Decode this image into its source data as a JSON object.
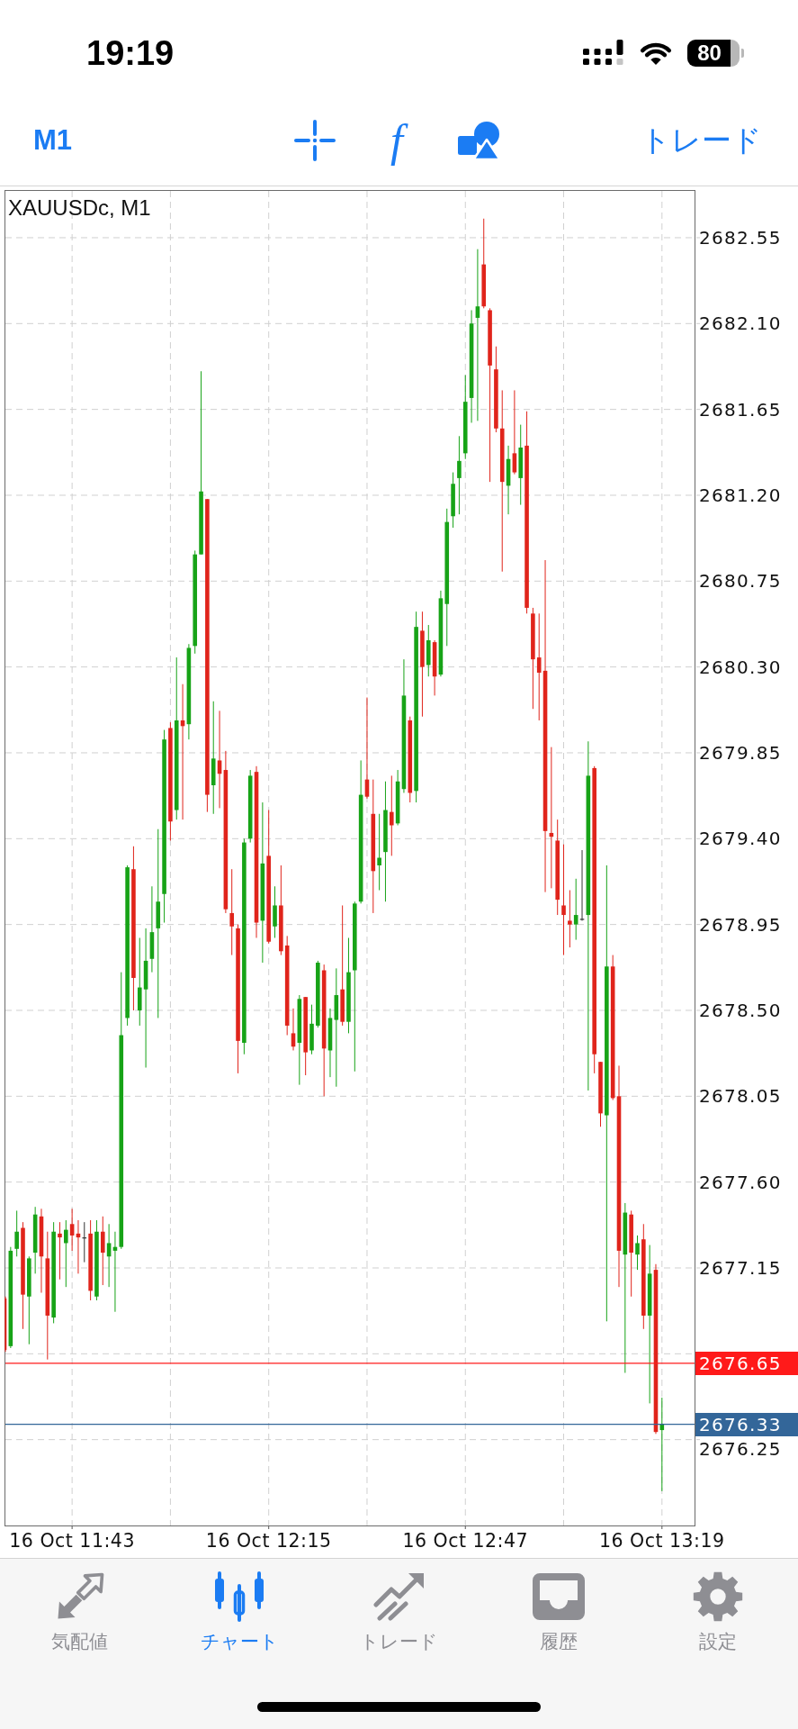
{
  "status_bar": {
    "time": "19:19",
    "battery": "80"
  },
  "toolbar": {
    "timeframe": "M1",
    "indicators": "f",
    "trade": "トレード"
  },
  "chart": {
    "chart_data": {
      "type": "candlestick",
      "title": "XAUUSDc, M1",
      "grid": true,
      "categories": [
        null,
        null,
        null,
        null,
        null,
        null,
        null,
        null,
        null,
        null,
        null,
        "16 Oct 11:43",
        null,
        null,
        null,
        null,
        null,
        null,
        null,
        null,
        null,
        null,
        null,
        null,
        null,
        null,
        null,
        null,
        null,
        null,
        null,
        null,
        null,
        null,
        null,
        null,
        null,
        null,
        null,
        null,
        null,
        null,
        null,
        "16 Oct 12:15",
        null,
        null,
        null,
        null,
        null,
        null,
        null,
        null,
        null,
        null,
        null,
        null,
        null,
        null,
        null,
        null,
        null,
        null,
        null,
        null,
        null,
        null,
        null,
        null,
        null,
        null,
        null,
        null,
        null,
        null,
        null,
        "16 Oct 12:47",
        null,
        null,
        null,
        null,
        null,
        null,
        null,
        null,
        null,
        null,
        null,
        null,
        null,
        null,
        null,
        null,
        null,
        null,
        null,
        null,
        null,
        null,
        null,
        null,
        null,
        null,
        null,
        null,
        null,
        null,
        null,
        "16 Oct 13:19"
      ],
      "ohlc": [
        [
          2676.99,
          2677.0,
          2676.71,
          2676.72
        ],
        [
          2676.74,
          2677.26,
          2676.73,
          2677.24
        ],
        [
          2677.25,
          2677.45,
          2677.21,
          2677.34
        ],
        [
          2677.36,
          2677.39,
          2676.83,
          2677.01
        ],
        [
          2677.0,
          2677.21,
          2676.75,
          2677.2
        ],
        [
          2677.23,
          2677.47,
          2677.12,
          2677.43
        ],
        [
          2677.42,
          2677.46,
          2677.02,
          2677.21
        ],
        [
          2677.2,
          2677.34,
          2676.67,
          2676.9
        ],
        [
          2676.89,
          2677.39,
          2676.86,
          2677.34
        ],
        [
          2677.33,
          2677.39,
          2677.09,
          2677.31
        ],
        [
          2677.28,
          2677.4,
          2677.05,
          2677.35
        ],
        [
          2677.38,
          2677.46,
          2677.24,
          2677.32
        ],
        [
          2677.33,
          2677.4,
          2677.12,
          2677.31
        ],
        [
          2677.31,
          2677.39,
          2677.18,
          2677.31
        ],
        [
          2677.33,
          2677.4,
          2676.98,
          2677.03
        ],
        [
          2677.0,
          2677.4,
          2676.98,
          2677.34
        ],
        [
          2677.34,
          2677.42,
          2677.06,
          2677.23
        ],
        [
          2677.21,
          2677.38,
          2677.05,
          2677.28
        ],
        [
          2677.24,
          2677.34,
          2676.92,
          2677.26
        ],
        [
          2677.26,
          2678.7,
          2677.25,
          2678.37
        ],
        [
          2678.46,
          2679.26,
          2678.42,
          2679.25
        ],
        [
          2679.24,
          2679.36,
          2678.5,
          2678.67
        ],
        [
          2678.5,
          2678.88,
          2678.42,
          2678.62
        ],
        [
          2678.61,
          2678.93,
          2678.2,
          2678.76
        ],
        [
          2678.77,
          2679.15,
          2678.7,
          2678.91
        ],
        [
          2678.93,
          2679.45,
          2678.46,
          2679.07
        ],
        [
          2679.11,
          2679.97,
          2678.96,
          2679.92
        ],
        [
          2679.98,
          2680.01,
          2679.39,
          2679.49
        ],
        [
          2679.55,
          2680.35,
          2679.5,
          2680.02
        ],
        [
          2680.02,
          2680.21,
          2679.5,
          2679.99
        ],
        [
          2680.0,
          2680.42,
          2679.92,
          2680.4
        ],
        [
          2680.41,
          2680.91,
          2680.37,
          2680.89
        ],
        [
          2680.89,
          2681.85,
          2680.89,
          2681.22
        ],
        [
          2681.18,
          2681.18,
          2679.54,
          2679.63
        ],
        [
          2679.68,
          2680.12,
          2679.53,
          2679.82
        ],
        [
          2679.81,
          2680.07,
          2679.56,
          2679.74
        ],
        [
          2679.76,
          2679.86,
          2679.01,
          2679.03
        ],
        [
          2679.01,
          2679.24,
          2678.79,
          2678.94
        ],
        [
          2678.93,
          2678.95,
          2678.17,
          2678.34
        ],
        [
          2678.33,
          2679.4,
          2678.27,
          2679.38
        ],
        [
          2679.4,
          2679.76,
          2679.38,
          2679.73
        ],
        [
          2679.75,
          2679.78,
          2678.88,
          2678.96
        ],
        [
          2678.97,
          2679.59,
          2678.75,
          2679.27
        ],
        [
          2679.31,
          2679.55,
          2678.85,
          2678.86
        ],
        [
          2678.94,
          2679.15,
          2678.88,
          2679.05
        ],
        [
          2679.05,
          2679.26,
          2678.79,
          2678.81
        ],
        [
          2678.84,
          2678.89,
          2678.37,
          2678.42
        ],
        [
          2678.38,
          2678.51,
          2678.29,
          2678.31
        ],
        [
          2678.33,
          2678.58,
          2678.11,
          2678.56
        ],
        [
          2678.57,
          2678.57,
          2678.16,
          2678.28
        ],
        [
          2678.29,
          2678.53,
          2678.27,
          2678.43
        ],
        [
          2678.42,
          2678.76,
          2678.41,
          2678.75
        ],
        [
          2678.71,
          2678.74,
          2678.05,
          2678.3
        ],
        [
          2678.29,
          2678.51,
          2678.15,
          2678.46
        ],
        [
          2678.45,
          2678.72,
          2678.1,
          2678.58
        ],
        [
          2678.61,
          2679.05,
          2678.42,
          2678.44
        ],
        [
          2678.44,
          2678.88,
          2678.38,
          2678.7
        ],
        [
          2678.71,
          2679.07,
          2678.18,
          2679.06
        ],
        [
          2679.07,
          2679.81,
          2679.06,
          2679.63
        ],
        [
          2679.71,
          2680.14,
          2679.61,
          2679.62
        ],
        [
          2679.53,
          2679.71,
          2679.01,
          2679.23
        ],
        [
          2679.26,
          2679.53,
          2679.13,
          2679.3
        ],
        [
          2679.33,
          2679.7,
          2679.07,
          2679.55
        ],
        [
          2679.54,
          2679.73,
          2679.31,
          2679.47
        ],
        [
          2679.48,
          2679.76,
          2679.47,
          2679.7
        ],
        [
          2679.66,
          2680.34,
          2679.64,
          2680.15
        ],
        [
          2680.02,
          2680.04,
          2679.59,
          2679.64
        ],
        [
          2679.65,
          2680.59,
          2679.59,
          2680.51
        ],
        [
          2680.49,
          2680.59,
          2680.04,
          2680.3
        ],
        [
          2680.31,
          2680.52,
          2680.25,
          2680.44
        ],
        [
          2680.43,
          2680.44,
          2680.15,
          2680.25
        ],
        [
          2680.26,
          2680.7,
          2680.25,
          2680.66
        ],
        [
          2680.63,
          2681.13,
          2680.41,
          2681.06
        ],
        [
          2681.09,
          2681.32,
          2681.03,
          2681.26
        ],
        [
          2681.29,
          2681.51,
          2681.1,
          2681.38
        ],
        [
          2681.42,
          2681.83,
          2681.39,
          2681.69
        ],
        [
          2681.71,
          2682.17,
          2681.58,
          2682.1
        ],
        [
          2682.13,
          2682.49,
          2681.59,
          2682.19
        ],
        [
          2682.41,
          2682.65,
          2682.18,
          2682.19
        ],
        [
          2682.17,
          2682.18,
          2681.27,
          2681.88
        ],
        [
          2681.86,
          2681.98,
          2681.53,
          2681.55
        ],
        [
          2681.55,
          2681.75,
          2680.8,
          2681.27
        ],
        [
          2681.25,
          2681.46,
          2681.1,
          2681.39
        ],
        [
          2681.42,
          2681.75,
          2681.31,
          2681.32
        ],
        [
          2681.29,
          2681.57,
          2681.15,
          2681.45
        ],
        [
          2681.46,
          2681.64,
          2680.58,
          2680.61
        ],
        [
          2680.58,
          2680.61,
          2680.08,
          2680.34
        ],
        [
          2680.35,
          2680.58,
          2680.02,
          2680.27
        ],
        [
          2680.28,
          2680.86,
          2679.12,
          2679.44
        ],
        [
          2679.43,
          2679.88,
          2679.14,
          2679.41
        ],
        [
          2679.39,
          2679.5,
          2679.0,
          2679.08
        ],
        [
          2679.05,
          2679.37,
          2678.79,
          2679.0
        ],
        [
          2678.97,
          2679.13,
          2678.83,
          2678.95
        ],
        [
          2678.95,
          2679.19,
          2678.87,
          2679.0
        ],
        [
          2678.98,
          2679.34,
          2678.97,
          2678.98
        ],
        [
          2679.0,
          2679.91,
          2678.08,
          2679.73
        ],
        [
          2679.77,
          2679.78,
          2678.17,
          2678.27
        ],
        [
          2678.23,
          2678.23,
          2677.89,
          2677.96
        ],
        [
          2677.95,
          2679.26,
          2676.87,
          2678.73
        ],
        [
          2678.73,
          2678.79,
          2678.03,
          2678.04
        ],
        [
          2678.05,
          2678.21,
          2677.05,
          2677.24
        ],
        [
          2677.22,
          2677.49,
          2676.6,
          2677.44
        ],
        [
          2677.43,
          2677.45,
          2677.0,
          2677.23
        ],
        [
          2677.22,
          2677.32,
          2677.14,
          2677.28
        ],
        [
          2677.3,
          2677.38,
          2676.83,
          2676.9
        ],
        [
          2676.9,
          2677.27,
          2676.44,
          2677.12
        ],
        [
          2677.14,
          2677.17,
          2676.28,
          2676.29
        ],
        [
          2676.3,
          2676.47,
          2675.98,
          2676.33
        ]
      ],
      "ylim": [
        2675.8,
        2682.8
      ],
      "yticks": [
        {
          "value": 2682.55,
          "label": "2682.55"
        },
        {
          "value": 2682.1,
          "label": "2682.10"
        },
        {
          "value": 2681.65,
          "label": "2681.65"
        },
        {
          "value": 2681.2,
          "label": "2681.20"
        },
        {
          "value": 2680.75,
          "label": "2680.75"
        },
        {
          "value": 2680.3,
          "label": "2680.30"
        },
        {
          "value": 2679.85,
          "label": "2679.85"
        },
        {
          "value": 2679.4,
          "label": "2679.40"
        },
        {
          "value": 2678.95,
          "label": "2678.95"
        },
        {
          "value": 2678.5,
          "label": "2678.50"
        },
        {
          "value": 2678.05,
          "label": "2678.05"
        },
        {
          "value": 2677.6,
          "label": "2677.60"
        },
        {
          "value": 2677.15,
          "label": "2677.15"
        },
        {
          "value": 2676.25,
          "label": "2676.25"
        }
      ],
      "ref_lines": [
        {
          "axis": "y",
          "value": 2676.65,
          "label": "2676.65",
          "color": "#ff1a1a"
        },
        {
          "axis": "y",
          "value": 2676.33,
          "label": "2676.33",
          "color": "#336699"
        }
      ]
    }
  },
  "tabs": [
    {
      "kind": "quotes",
      "label": "気配値",
      "selected": false
    },
    {
      "kind": "chart",
      "label": "チャート",
      "selected": true
    },
    {
      "kind": "trade",
      "label": "トレード",
      "selected": false
    },
    {
      "kind": "history",
      "label": "履歴",
      "selected": false
    },
    {
      "kind": "settings",
      "label": "設定",
      "selected": false
    }
  ]
}
